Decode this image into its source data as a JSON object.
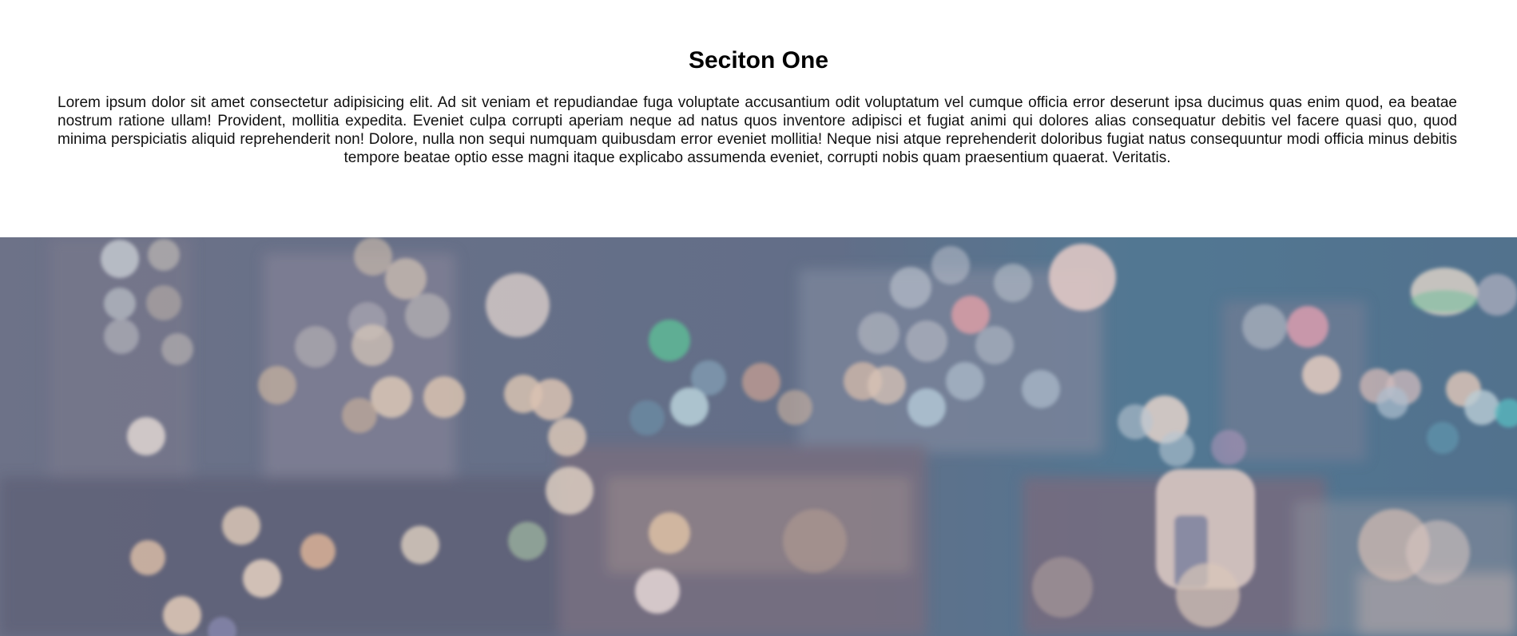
{
  "section_one": {
    "title": "Seciton One",
    "body": "Lorem ipsum dolor sit amet consectetur adipisicing elit. Ad sit veniam et repudiandae fuga voluptate accusantium odit voluptatum vel cumque officia error deserunt ipsa ducimus quas enim quod, ea beatae nostrum ratione ullam! Provident, mollitia expedita. Eveniet culpa corrupti aperiam neque ad natus quos inventore adipisci et fugiat animi qui dolores alias consequatur debitis vel facere quasi quo, quod minima perspiciatis aliquid reprehenderit non! Dolore, nulla non sequi numquam quibusdam error eveniet mollitia! Neque nisi atque reprehenderit doloribus fugiat natus consequuntur modi officia minus debitis tempore beatae optio esse magni itaque explicabo assumenda eveniet, corrupti nobis quam praesentium quaerat. Veritatis."
  },
  "hero": {
    "image_description": "blurred city lights bokeh background",
    "colors": {
      "overlay": "#646a82",
      "warm_light": "#f5d8bf",
      "teal_light": "#bfe3e6",
      "green_light": "#5cc69a",
      "pink_light": "#f1b0b7"
    }
  }
}
